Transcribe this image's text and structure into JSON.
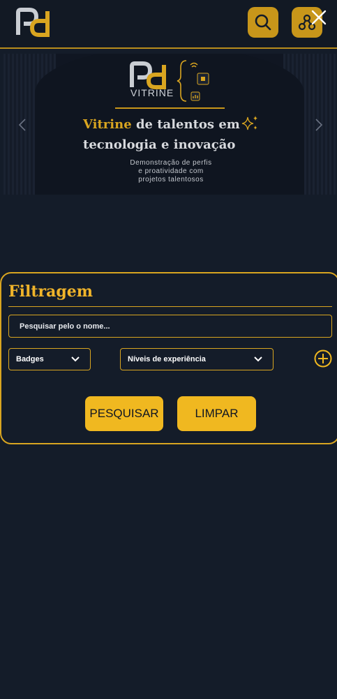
{
  "header": {
    "logo_icon": "pd-logo-icon",
    "search_icon": "search-icon",
    "network_icon": "network-icon",
    "close_icon": "close-icon"
  },
  "banner": {
    "brand": "VITRINE",
    "headline_accent": "Vitrine",
    "headline_rest": " de talentos em tecnologia e inovação",
    "subtitle_lines": [
      "Demonstração de perfis",
      "e proatividade com",
      "projetos talentosos"
    ],
    "prev_icon": "chevron-left-icon",
    "next_icon": "chevron-right-icon"
  },
  "filter": {
    "title": "Filtragem",
    "search_placeholder": "Pesquisar pelo o nome...",
    "badges_label": "Badges",
    "levels_label": "Níveis de experiência",
    "add_icon": "plus-circle-icon",
    "search_button": "PESQUISAR",
    "clear_button": "LIMPAR"
  },
  "colors": {
    "background": "#141c29",
    "accent": "#d9a520",
    "button": "#f0b820"
  }
}
